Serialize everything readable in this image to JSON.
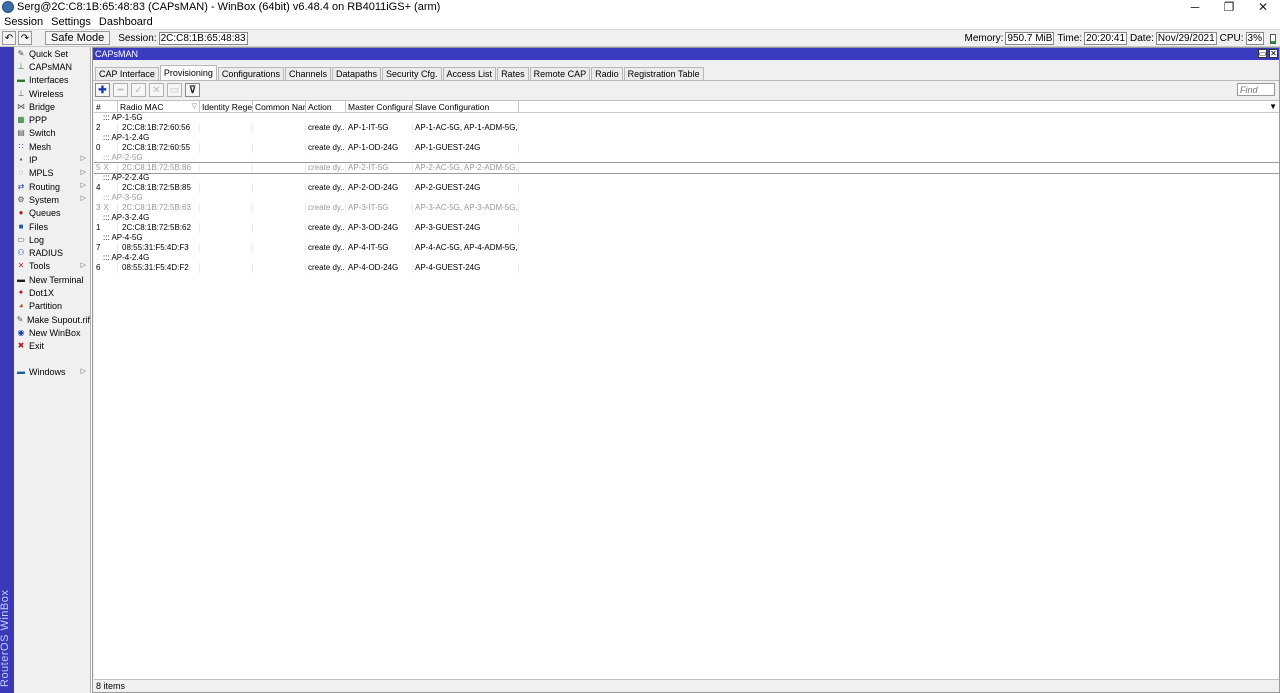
{
  "window": {
    "title": "Serg@2C:C8:1B:65:48:83 (CAPsMAN) - WinBox (64bit) v6.48.4 on RB4011iGS+ (arm)",
    "minimize": "─",
    "restore": "❐",
    "close": "✕"
  },
  "menu": [
    "Session",
    "Settings",
    "Dashboard"
  ],
  "toolbar": {
    "undo_icon": "↶",
    "redo_icon": "↷",
    "safe_mode": "Safe Mode",
    "session_label": "Session:",
    "session_value": "2C:C8:1B:65:48:83",
    "memory_label": "Memory:",
    "memory_value": "950.7 MiB",
    "time_label": "Time:",
    "time_value": "20:20:41",
    "date_label": "Date:",
    "date_value": "Nov/29/2021",
    "cpu_label": "CPU:",
    "cpu_value": "3%",
    "cpu_fraction": 0.03
  },
  "brand": "RouterOS WinBox",
  "sidebar": [
    {
      "label": "Quick Set",
      "icon": "✎",
      "color": "#444",
      "submenu": false
    },
    {
      "label": "CAPsMAN",
      "icon": "⊥",
      "color": "#2a7a2a",
      "submenu": false
    },
    {
      "label": "Interfaces",
      "icon": "▬",
      "color": "#2a7a2a",
      "submenu": false
    },
    {
      "label": "Wireless",
      "icon": "⊥",
      "color": "#555",
      "submenu": false
    },
    {
      "label": "Bridge",
      "icon": "⋈",
      "color": "#555",
      "submenu": false
    },
    {
      "label": "PPP",
      "icon": "▦",
      "color": "#2a7a2a",
      "submenu": false
    },
    {
      "label": "Switch",
      "icon": "▤",
      "color": "#555",
      "submenu": false
    },
    {
      "label": "Mesh",
      "icon": "∷",
      "color": "#1a3ea8",
      "submenu": false
    },
    {
      "label": "IP",
      "icon": "▪",
      "color": "#555",
      "submenu": true
    },
    {
      "label": "MPLS",
      "icon": "◌",
      "color": "#555",
      "submenu": true
    },
    {
      "label": "Routing",
      "icon": "⇄",
      "color": "#1a3ea8",
      "submenu": true
    },
    {
      "label": "System",
      "icon": "⚙",
      "color": "#555",
      "submenu": true
    },
    {
      "label": "Queues",
      "icon": "●",
      "color": "#b02020",
      "submenu": false
    },
    {
      "label": "Files",
      "icon": "■",
      "color": "#1a5ea8",
      "submenu": false
    },
    {
      "label": "Log",
      "icon": "▭",
      "color": "#555",
      "submenu": false
    },
    {
      "label": "RADIUS",
      "icon": "⚇",
      "color": "#1a3ea8",
      "submenu": false
    },
    {
      "label": "Tools",
      "icon": "✕",
      "color": "#b02020",
      "submenu": true
    },
    {
      "label": "New Terminal",
      "icon": "▬",
      "color": "#222",
      "submenu": false
    },
    {
      "label": "Dot1X",
      "icon": "✦",
      "color": "#b02020",
      "submenu": false
    },
    {
      "label": "Partition",
      "icon": "◕",
      "color": "#c05010",
      "submenu": false
    },
    {
      "label": "Make Supout.rif",
      "icon": "✎",
      "color": "#555",
      "submenu": false
    },
    {
      "label": "New WinBox",
      "icon": "◉",
      "color": "#1a3ea8",
      "submenu": false
    },
    {
      "label": "Exit",
      "icon": "✖",
      "color": "#b02020",
      "submenu": false
    }
  ],
  "sidebar_windows": {
    "label": "Windows",
    "icon": "▬",
    "color": "#1a5ea8",
    "submenu": true
  },
  "panel": {
    "title": "CAPsMAN",
    "restore_icon": "▭",
    "close_icon": "✕",
    "tabs": [
      "CAP Interface",
      "Provisioning",
      "Configurations",
      "Channels",
      "Datapaths",
      "Security Cfg.",
      "Access List",
      "Rates",
      "Remote CAP",
      "Radio",
      "Registration Table"
    ],
    "active_tab": 1,
    "actions": {
      "add": "✚",
      "remove": "━",
      "enable": "✓",
      "disable": "✕",
      "comment": "▭",
      "filter": "⊽"
    },
    "find_placeholder": "Find",
    "columns": [
      "#",
      "Radio MAC",
      "Identity Regexp",
      "Common Nam...",
      "Action",
      "Master Configurati...",
      "Slave Configuration"
    ],
    "sort_marker": "▽",
    "dropdown_icon": "▼",
    "groups": [
      {
        "comment": "::: AP-1-5G",
        "disabled": false,
        "row": {
          "num": "2",
          "flag": "",
          "mac": "2C:C8:1B:72:60:56",
          "action": "create dy...",
          "master": "AP-1-IT-5G",
          "slave": "AP-1-AC-5G, AP-1-ADM-5G, A..."
        }
      },
      {
        "comment": "::: AP-1-2.4G",
        "disabled": false,
        "row": {
          "num": "0",
          "flag": "",
          "mac": "2C:C8:1B:72:60:55",
          "action": "create dy...",
          "master": "AP-1-OD-24G",
          "slave": "AP-1-GUEST-24G"
        }
      },
      {
        "comment": "::: AP-2-5G",
        "disabled": true,
        "row": {
          "num": "5",
          "flag": "X",
          "mac": "2C:C8:1B:72:5B:86",
          "action": "create dy...",
          "master": "AP-2-IT-5G",
          "slave": "AP-2-AC-5G, AP-2-ADM-5G, A..."
        }
      },
      {
        "comment": "::: AP-2-2.4G",
        "disabled": false,
        "row": {
          "num": "4",
          "flag": "",
          "mac": "2C:C8:1B:72:5B:85",
          "action": "create dy...",
          "master": "AP-2-OD-24G",
          "slave": "AP-2-GUEST-24G"
        }
      },
      {
        "comment": "::: AP-3-5G",
        "disabled": true,
        "row": {
          "num": "3",
          "flag": "X",
          "mac": "2C:C8:1B:72:5B:63",
          "action": "create dy...",
          "master": "AP-3-IT-5G",
          "slave": "AP-3-AC-5G, AP-3-ADM-5G, A..."
        }
      },
      {
        "comment": "::: AP-3-2.4G",
        "disabled": false,
        "row": {
          "num": "1",
          "flag": "",
          "mac": "2C:C8:1B:72:5B:62",
          "action": "create dy...",
          "master": "AP-3-OD-24G",
          "slave": "AP-3-GUEST-24G"
        }
      },
      {
        "comment": "::: AP-4-5G",
        "disabled": false,
        "row": {
          "num": "7",
          "flag": "",
          "mac": "08:55:31:F5:4D:F3",
          "action": "create dy...",
          "master": "AP-4-IT-5G",
          "slave": "AP-4-AC-5G, AP-4-ADM-5G, A..."
        }
      },
      {
        "comment": "::: AP-4-2.4G",
        "disabled": false,
        "row": {
          "num": "6",
          "flag": "",
          "mac": "08:55:31:F5:4D:F2",
          "action": "create dy...",
          "master": "AP-4-OD-24G",
          "slave": "AP-4-GUEST-24G"
        }
      }
    ],
    "status": "8 items"
  }
}
